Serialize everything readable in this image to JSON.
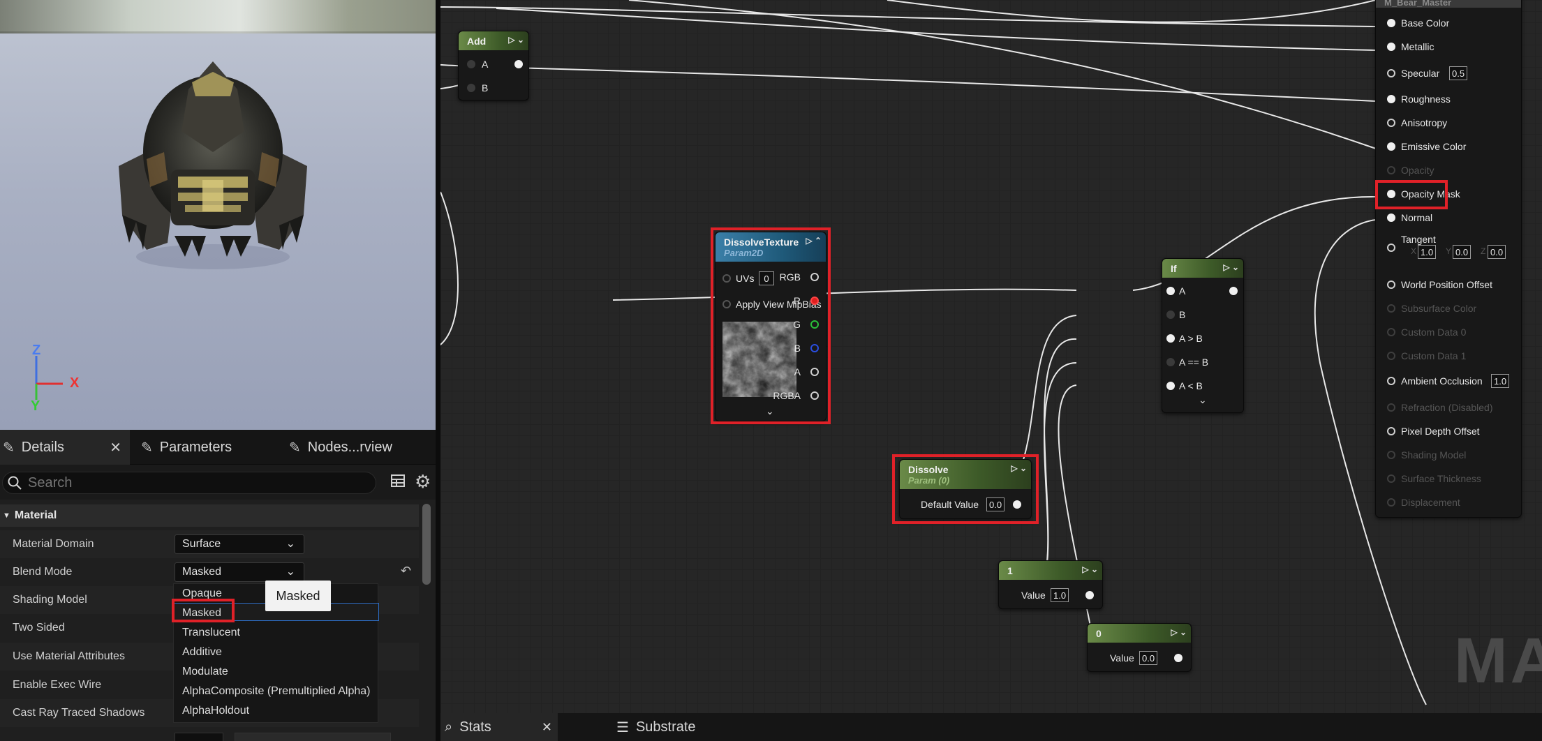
{
  "viewport": {
    "axes": {
      "z": "Z",
      "x": "X",
      "y": "Y"
    }
  },
  "tabs": {
    "details": "Details",
    "parameters": "Parameters",
    "nodes_overview": "Nodes...rview",
    "close_glyph": "✕"
  },
  "search": {
    "placeholder": "Search"
  },
  "details_panel": {
    "category": "Material",
    "properties": [
      {
        "label": "Material Domain",
        "value": "Surface"
      },
      {
        "label": "Blend Mode",
        "value": "Masked"
      },
      {
        "label": "Shading Model"
      },
      {
        "label": "Two Sided"
      },
      {
        "label": "Use Material Attributes"
      },
      {
        "label": "Enable Exec Wire"
      },
      {
        "label": "Cast Ray Traced Shadows"
      }
    ],
    "blend_mode_options": [
      "Opaque",
      "Masked",
      "Translucent",
      "Additive",
      "Modulate",
      "AlphaComposite (Premultiplied Alpha)",
      "AlphaHoldout"
    ],
    "tooltip": "Masked"
  },
  "graph": {
    "watermark": "MAT",
    "add_node": {
      "title": "Add",
      "pins": [
        "A",
        "B"
      ]
    },
    "texture_node": {
      "title": "DissolveTexture",
      "subtitle": "Param2D",
      "uvs_label": "UVs",
      "uvs_value": "0",
      "mipbias_label": "Apply View MipBias",
      "outputs": [
        "RGB",
        "R",
        "G",
        "B",
        "A",
        "RGBA"
      ]
    },
    "dissolve_node": {
      "title": "Dissolve",
      "subtitle": "Param (0)",
      "label": "Default Value",
      "value": "0.0"
    },
    "const1_node": {
      "title": "1",
      "label": "Value",
      "value": "1.0"
    },
    "const0_node": {
      "title": "0",
      "label": "Value",
      "value": "0.0"
    },
    "if_node": {
      "title": "If",
      "pins": [
        "A",
        "B",
        "A > B",
        "A == B",
        "A < B"
      ]
    },
    "material_node": {
      "title": "M_Bear_Master",
      "pins": [
        {
          "label": "Base Color",
          "state": "connected"
        },
        {
          "label": "Metallic",
          "state": "connected"
        },
        {
          "label": "Specular",
          "state": "ring",
          "value": "0.5"
        },
        {
          "label": "Roughness",
          "state": "connected"
        },
        {
          "label": "Anisotropy",
          "state": "ring"
        },
        {
          "label": "Emissive Color",
          "state": "connected"
        },
        {
          "label": "Opacity",
          "state": "disabled"
        },
        {
          "label": "Opacity Mask",
          "state": "connected"
        },
        {
          "label": "Normal",
          "state": "connected"
        },
        {
          "label": "Tangent",
          "state": "ring"
        },
        {
          "label": "World Position Offset",
          "state": "ring"
        },
        {
          "label": "Subsurface Color",
          "state": "disabled"
        },
        {
          "label": "Custom Data 0",
          "state": "disabled"
        },
        {
          "label": "Custom Data 1",
          "state": "disabled"
        },
        {
          "label": "Ambient Occlusion",
          "state": "ring",
          "value": "1.0"
        },
        {
          "label": "Refraction (Disabled)",
          "state": "disabled"
        },
        {
          "label": "Pixel Depth Offset",
          "state": "ring"
        },
        {
          "label": "Shading Model",
          "state": "disabled"
        },
        {
          "label": "Surface Thickness",
          "state": "disabled"
        },
        {
          "label": "Displacement",
          "state": "disabled"
        }
      ],
      "tangent_fields": [
        {
          "axis": "X",
          "value": "1.0"
        },
        {
          "axis": "Y",
          "value": "0.0"
        },
        {
          "axis": "Z",
          "value": "0.0"
        }
      ]
    }
  },
  "bottom_tabs": {
    "stats": "Stats",
    "substrate": "Substrate",
    "close_glyph": "✕"
  },
  "colors": {
    "highlight_red": "#e02128",
    "selection_blue": "#2d6ec7",
    "param_green": "#6a8a48",
    "texture_blue": "#3b7fa8"
  }
}
